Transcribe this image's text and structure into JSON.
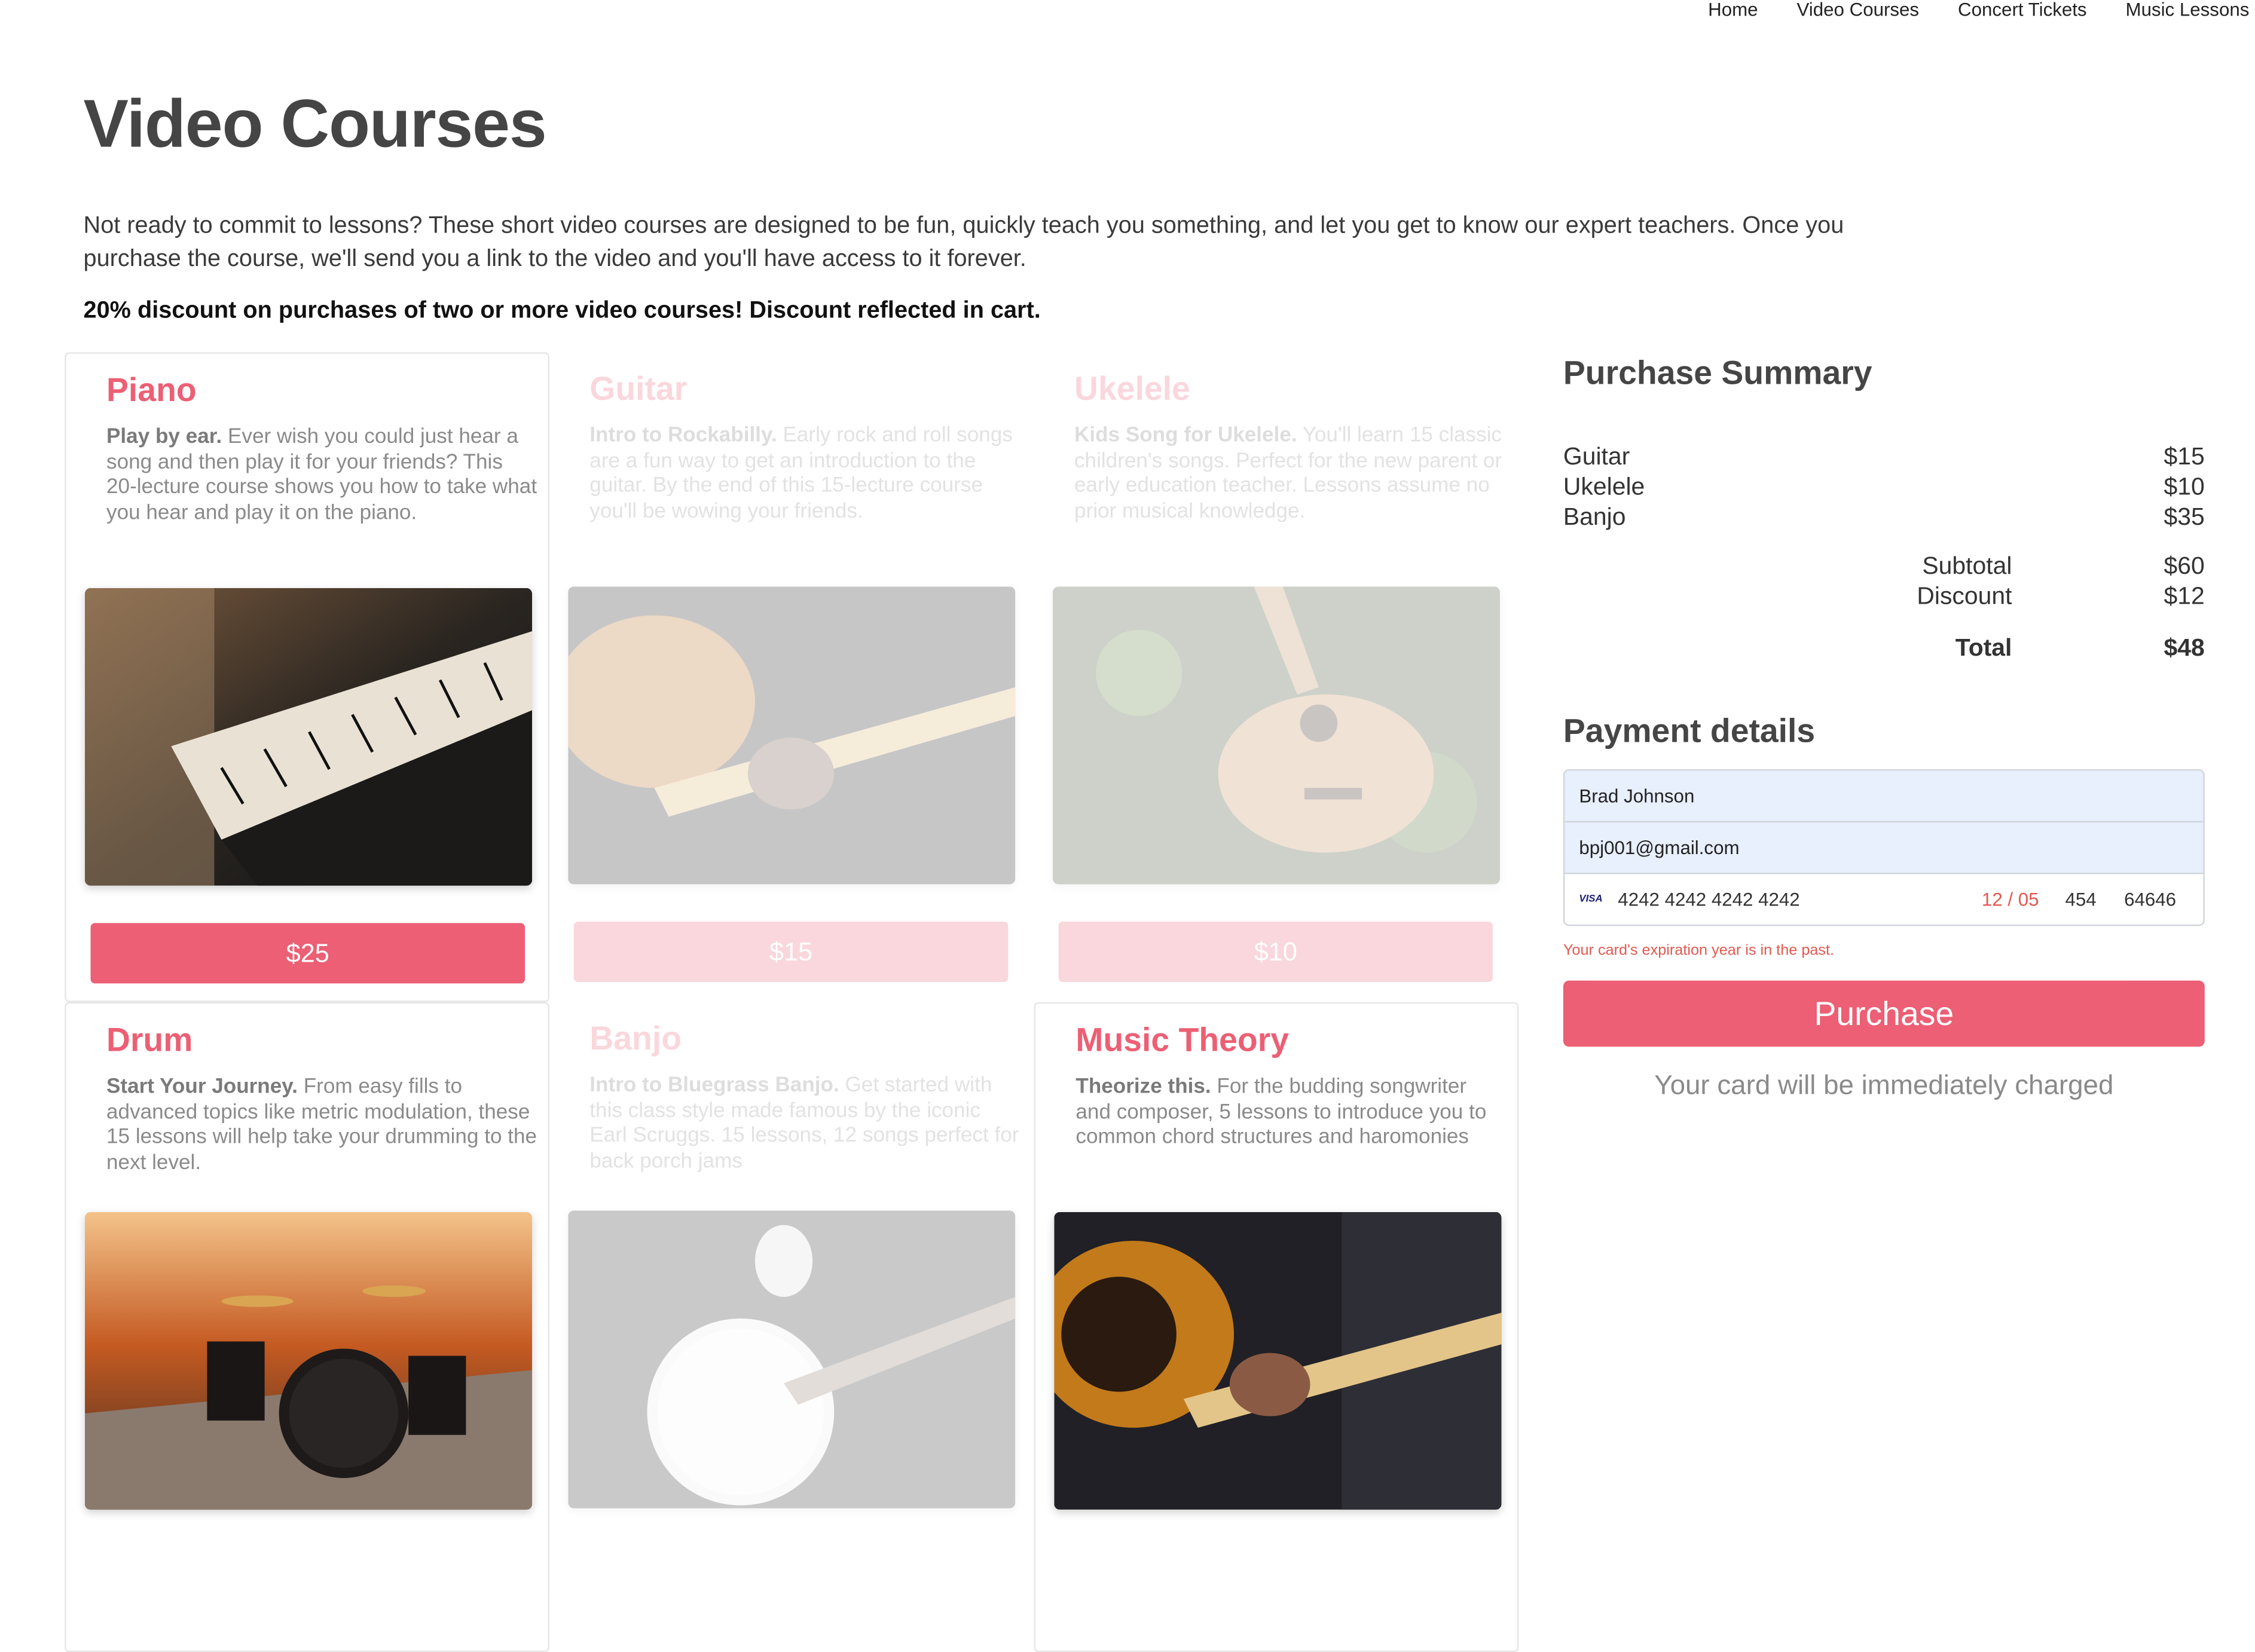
{
  "nav": [
    "Home",
    "Video Courses",
    "Concert Tickets",
    "Music Lessons"
  ],
  "page_title": "Video Courses",
  "intro": "Not ready to commit to lessons? These short video courses are designed to be fun, quickly teach you something, and let you get to know our expert teachers. Once you purchase the course, we'll send you a link to the video and you'll have access to it forever.",
  "promo": "20% discount on purchases of two or more video courses! Discount reflected in cart.",
  "courses": [
    {
      "name": "Piano",
      "lead": "Play by ear.",
      "text": " Ever wish you could just hear a song and then play it for your friends? This 20-lecture course shows you how to take what you hear and play it on the piano.",
      "price": "$25",
      "in_cart": false,
      "image": "piano-photo"
    },
    {
      "name": "Guitar",
      "lead": "Intro to Rockabilly.",
      "text": " Early rock and roll songs are a fun way to get an introduction to the guitar. By the end of this 15-lecture course you'll be wowing your friends.",
      "price": "$15",
      "in_cart": true,
      "image": "guitar-photo"
    },
    {
      "name": "Ukelele",
      "lead": "Kids Song for Ukelele.",
      "text": " You'll learn 15 classic children's songs. Perfect for the new parent or early education teacher. Lessons assume no prior musical knowledge.",
      "price": "$10",
      "in_cart": true,
      "image": "ukelele-photo"
    },
    {
      "name": "Drum",
      "lead": "Start Your Journey.",
      "text": " From easy fills to advanced topics like metric modulation, these 15 lessons will help take your drumming to the next level.",
      "price": "",
      "in_cart": false,
      "image": "drum-photo"
    },
    {
      "name": "Banjo",
      "lead": "Intro to Bluegrass Banjo.",
      "text": " Get started with this class style made famous by the iconic Earl Scruggs. 15 lessons, 12 songs perfect for back porch jams",
      "price": "",
      "in_cart": true,
      "image": "banjo-photo"
    },
    {
      "name": "Music Theory",
      "lead": "Theorize this.",
      "text": " For the budding songwriter and composer, 5 lessons to introduce you to common chord structures and haromonies",
      "price": "",
      "in_cart": false,
      "image": "music-theory-photo"
    }
  ],
  "summary": {
    "title": "Purchase Summary",
    "items": [
      {
        "name": "Guitar",
        "price": "$15"
      },
      {
        "name": "Ukelele",
        "price": "$10"
      },
      {
        "name": "Banjo",
        "price": "$35"
      }
    ],
    "subtotal_label": "Subtotal",
    "subtotal": "$60",
    "discount_label": "Discount",
    "discount": "$12",
    "total_label": "Total",
    "total": "$48"
  },
  "payment": {
    "title": "Payment details",
    "name": "Brad Johnson",
    "email": "bpj001@gmail.com",
    "card_brand": "VISA",
    "card_number": "4242 4242 4242 4242",
    "expiry": "12 / 05",
    "cvc": "454",
    "zip": "64646",
    "error": "Your card's expiration year is in the past.",
    "purchase_label": "Purchase",
    "charge_note": "Your card will be immediately charged"
  },
  "colors": {
    "accent": "#ec5f74",
    "error": "#e25950",
    "autofill": "#e8effd"
  }
}
